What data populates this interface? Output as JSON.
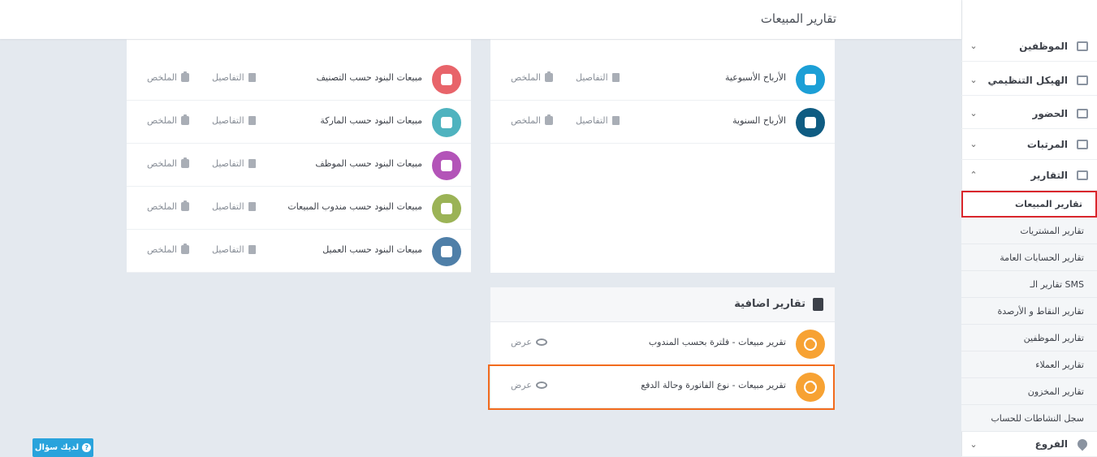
{
  "header": {
    "title": "تقارير المبيعات"
  },
  "sidebar": {
    "items": [
      {
        "label": "الموظفين",
        "icon": "users-icon",
        "chevron": "⌄"
      },
      {
        "label": "الهيكل التنظيمي",
        "icon": "org-chart-icon",
        "chevron": "⌄"
      },
      {
        "label": "الحضور",
        "icon": "calendar-icon",
        "chevron": "⌄"
      },
      {
        "label": "المرتبات",
        "icon": "money-icon",
        "chevron": "⌄"
      },
      {
        "label": "التقارير",
        "icon": "bar-chart-icon",
        "chevron": "⌃"
      }
    ],
    "subitems": [
      "تقارير المبيعات",
      "تقارير المشتريات",
      "تقارير الحسابات العامة",
      "تقارير الـ SMS",
      "تقارير النقاط و الأرصدة",
      "تقارير الموظفين",
      "تقارير العملاء",
      "تقارير المخزون",
      "سجل النشاطات للحساب"
    ],
    "branches": {
      "label": "الفروع",
      "icon": "location-icon",
      "chevron": "⌄"
    }
  },
  "left_card": {
    "rows": [
      {
        "label": "مبيعات البنود حسب التصنيف",
        "color": "#e8646a",
        "icon": "boxes-icon"
      },
      {
        "label": "مبيعات البنود حسب الماركة",
        "color": "#4fb3bf",
        "icon": "tag-icon"
      },
      {
        "label": "مبيعات البنود حسب الموظف",
        "color": "#b354b8",
        "icon": "user-icon"
      },
      {
        "label": "مبيعات البنود حسب مندوب المبيعات",
        "color": "#9bb356",
        "icon": "user-tag-icon"
      },
      {
        "label": "مبيعات البنود حسب العميل",
        "color": "#4f7fa8",
        "icon": "customer-icon"
      }
    ],
    "details": "التفاصيل",
    "summary": "الملخص"
  },
  "right_card": {
    "rows": [
      {
        "label": "الأرباح الأسبوعية",
        "color": "#1c9fd6",
        "icon": "calendar-week-icon"
      },
      {
        "label": "الأرباح السنوية",
        "color": "#0f5c82",
        "icon": "calendar-star-icon"
      }
    ],
    "details": "التفاصيل",
    "summary": "الملخص"
  },
  "extra": {
    "title": "تقارير اضافية",
    "rows": [
      {
        "label": "تقرير مبيعات - فلترة بحسب المندوب",
        "action": "عرض"
      },
      {
        "label": "تقرير مبيعات - نوع الفاتورة وحالة الدفع",
        "action": "عرض"
      }
    ],
    "color": "#f7a233"
  },
  "help": {
    "label": "لديك سؤال"
  },
  "colors": {
    "highlight": "#f26b1d",
    "active_border": "#d9262c",
    "help": "#29a3dc"
  }
}
